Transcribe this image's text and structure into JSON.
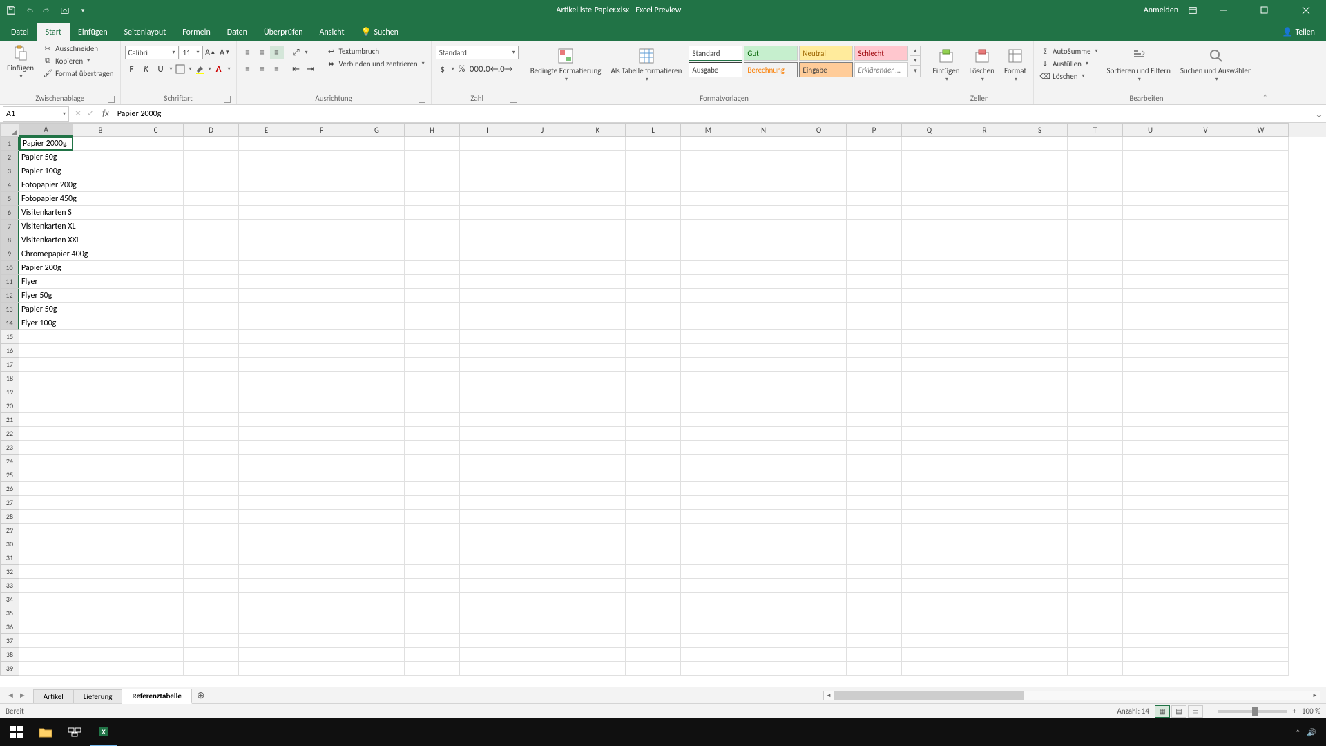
{
  "title": "Artikelliste-Papier.xlsx  -  Excel Preview",
  "account": {
    "signin": "Anmelden"
  },
  "menu": {
    "file": "Datei",
    "tabs": [
      "Start",
      "Einfügen",
      "Seitenlayout",
      "Formeln",
      "Daten",
      "Überprüfen",
      "Ansicht"
    ],
    "search": "Suchen",
    "share": "Teilen"
  },
  "ribbon": {
    "clipboard": {
      "paste": "Einfügen",
      "cut": "Ausschneiden",
      "copy": "Kopieren",
      "fmtpaint": "Format übertragen",
      "label": "Zwischenablage"
    },
    "font": {
      "name": "Calibri",
      "size": "11",
      "label": "Schriftart"
    },
    "align": {
      "wrap": "Textumbruch",
      "merge": "Verbinden und zentrieren",
      "label": "Ausrichtung"
    },
    "number": {
      "format": "Standard",
      "label": "Zahl"
    },
    "styles": {
      "cond": "Bedingte Formatierung",
      "table": "Als Tabelle formatieren",
      "cells": [
        "Standard",
        "Gut",
        "Neutral",
        "Schlecht",
        "Ausgabe",
        "Berechnung",
        "Eingabe",
        "Erklärender …"
      ],
      "label": "Formatvorlagen"
    },
    "cells": {
      "insert": "Einfügen",
      "delete": "Löschen",
      "format": "Format",
      "label": "Zellen"
    },
    "editing": {
      "autosum": "AutoSumme",
      "fill": "Ausfüllen",
      "clear": "Löschen",
      "sort": "Sortieren und Filtern",
      "find": "Suchen und Auswählen",
      "label": "Bearbeiten"
    }
  },
  "formula": {
    "ref": "A1",
    "value": "Papier 2000g"
  },
  "columns": [
    "A",
    "B",
    "C",
    "D",
    "E",
    "F",
    "G",
    "H",
    "I",
    "J",
    "K",
    "L",
    "M",
    "N",
    "O",
    "P",
    "Q",
    "R",
    "S",
    "T",
    "U",
    "V",
    "W"
  ],
  "colwidths": {
    "A": 78,
    "other": 80
  },
  "data": {
    "A": [
      "Papier 2000g",
      "Papier 50g",
      "Papier 100g",
      "Fotopapier 200g",
      "Fotopapier 450g",
      "Visitenkarten S",
      "Visitenkarten XL",
      "Visitenkarten XXL",
      "Chromepapier 400g",
      "Papier 200g",
      "Flyer",
      "Flyer 50g",
      "Papier 50g",
      "Flyer 100g"
    ]
  },
  "rowcount": 39,
  "sheets": {
    "tabs": [
      "Artikel",
      "Lieferung",
      "Referenztabelle"
    ],
    "active": 2
  },
  "status": {
    "ready": "Bereit",
    "count": "Anzahl: 14",
    "zoom": "100 %"
  }
}
